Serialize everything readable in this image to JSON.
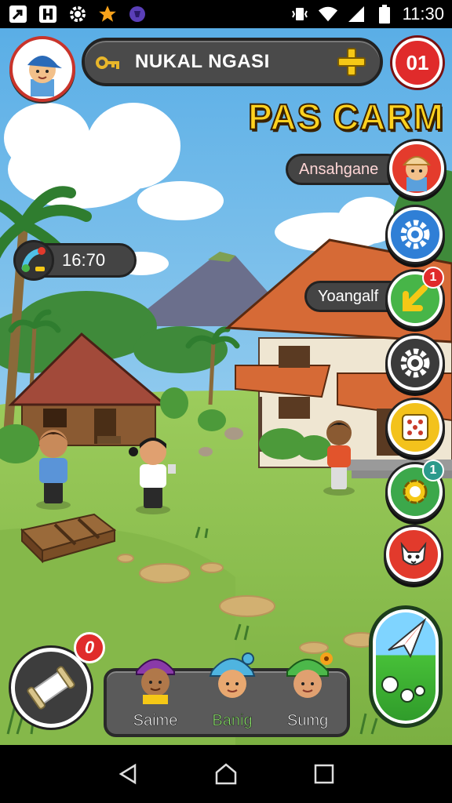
{
  "status_bar": {
    "time": "11:30",
    "left_icons": [
      "app-icon-arrow",
      "app-icon-frame",
      "gear-icon",
      "star-icon",
      "shield-icon"
    ],
    "right_icons": [
      "vibrate-icon",
      "wifi-icon",
      "signal-icon",
      "battery-icon"
    ]
  },
  "hud": {
    "player_name": "NUKAL NGASI",
    "currency_icon": "key-icon",
    "count_badge": "01",
    "game_title": "PAS CARM",
    "timer": "16:70",
    "colors": {
      "accent_yellow": "#ffd21f",
      "badge_red": "#e02b2b",
      "panel_gray": "#4a4a4a"
    }
  },
  "side_menu": {
    "items": [
      {
        "label": "Ansahgane",
        "icon": "portrait-icon"
      },
      {
        "label": "",
        "icon": "gear-icon"
      },
      {
        "label": "Yoangalf",
        "icon": "arrow-icon",
        "badge": "1"
      },
      {
        "label": "",
        "icon": "gear-icon"
      },
      {
        "label": "",
        "icon": "grid-icon"
      },
      {
        "label": "",
        "icon": "ring-icon",
        "badge": "1"
      },
      {
        "label": "",
        "icon": "fox-icon"
      }
    ]
  },
  "bottom": {
    "scroll_badge": "0",
    "characters": [
      {
        "name": "Saime"
      },
      {
        "name": "Banig"
      },
      {
        "name": "Sumg"
      }
    ]
  },
  "nav_bar": {
    "buttons": [
      "back",
      "home",
      "recents"
    ]
  }
}
